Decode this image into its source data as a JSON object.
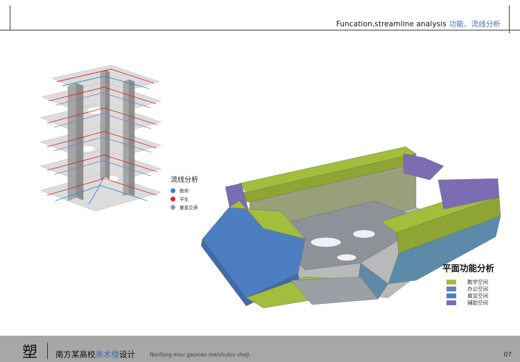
{
  "header": {
    "title_en": "Funcation,streamline analysis",
    "title_cn": "功能、流线分析"
  },
  "flow_legend": {
    "title": "流线分析",
    "items": [
      {
        "label": "教师",
        "color": "#2f86d6"
      },
      {
        "label": "学生",
        "color": "#d82525"
      },
      {
        "label": "垂直交通",
        "color": "#9a9a9a"
      }
    ]
  },
  "function_legend": {
    "title": "平面功能分析",
    "items": [
      {
        "label": "教学空间",
        "color": "#a3bd3c"
      },
      {
        "label": "办公空间",
        "color": "#5c8aa8"
      },
      {
        "label": "展览空间",
        "color": "#4d7ec2"
      },
      {
        "label": "辅助空间",
        "color": "#7b6cb3"
      }
    ]
  },
  "footer": {
    "logo": "塑",
    "title_prefix": "南方某高校",
    "title_highlight": "美术楼",
    "title_suffix": "设计",
    "subtitle": "Nanfang mou gaoxiao meishulou sheji",
    "page": "07"
  }
}
